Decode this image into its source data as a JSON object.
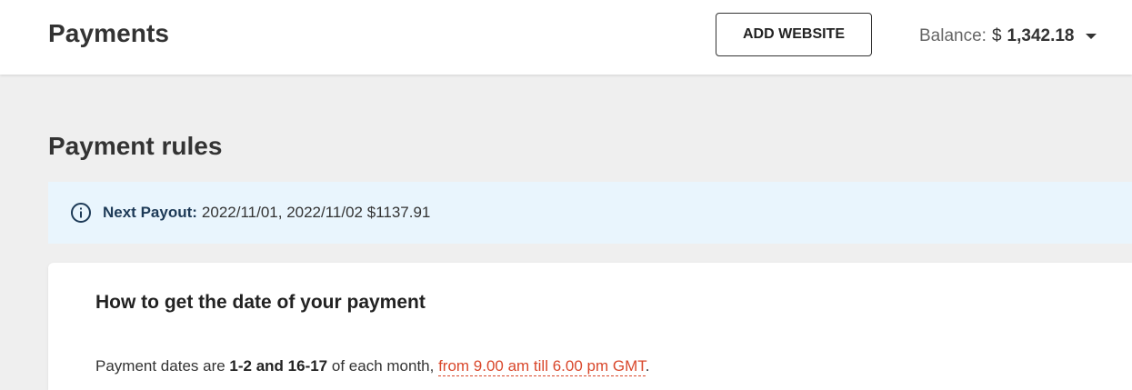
{
  "header": {
    "title": "Payments",
    "add_website_label": "ADD WEBSITE",
    "balance_label": "Balance:",
    "balance_currency": "$",
    "balance_amount": "1,342.18"
  },
  "rules": {
    "title": "Payment rules",
    "next_payout_label": "Next Payout:",
    "next_payout_value": "2022/11/01, 2022/11/02 $1137.91"
  },
  "card": {
    "title": "How to get the date of your payment",
    "text_prefix": "Payment dates are ",
    "text_dates": "1-2 and 16-17",
    "text_middle": " of each month, ",
    "text_time_link": "from 9.00 am till 6.00 pm GMT",
    "text_suffix": "."
  },
  "colors": {
    "accent_link": "#d9472b",
    "banner_bg": "#e9f5fd",
    "page_bg": "#efefef"
  },
  "icons": {
    "info": "info-circle-icon",
    "balance_dropdown": "caret-down-icon"
  }
}
